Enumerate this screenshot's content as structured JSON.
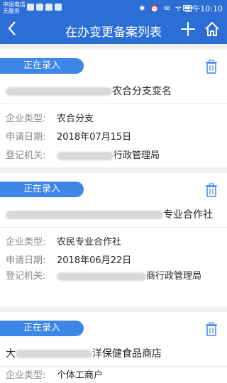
{
  "status_bar": {
    "carrier_line1": "中国电信",
    "carrier_line2": "无服务",
    "icons_right": "✱ ⏰ ✉ ᯤ",
    "battery_icon": "battery-icon",
    "time": "上午10:10"
  },
  "nav": {
    "back_icon": "‹",
    "title": "在办变更备案列表",
    "add_icon": "+",
    "home_icon": "home-icon"
  },
  "labels": {
    "status": "正在录入",
    "type": "企业类型:",
    "date": "申请日期:",
    "authority": "登记机关:"
  },
  "cards": [
    {
      "name_suffix": "农合分支变名",
      "type": "农合分支",
      "date": "2018年07月15日",
      "authority_suffix": "行政管理局"
    },
    {
      "name_suffix": "专业合作社",
      "type": "农民专业合作社",
      "date": "2018年06月22日",
      "authority_suffix": "商行政管理局"
    },
    {
      "name_prefix": "大",
      "name_suffix": "洋保健食品商店",
      "type": "个体工商户"
    }
  ]
}
